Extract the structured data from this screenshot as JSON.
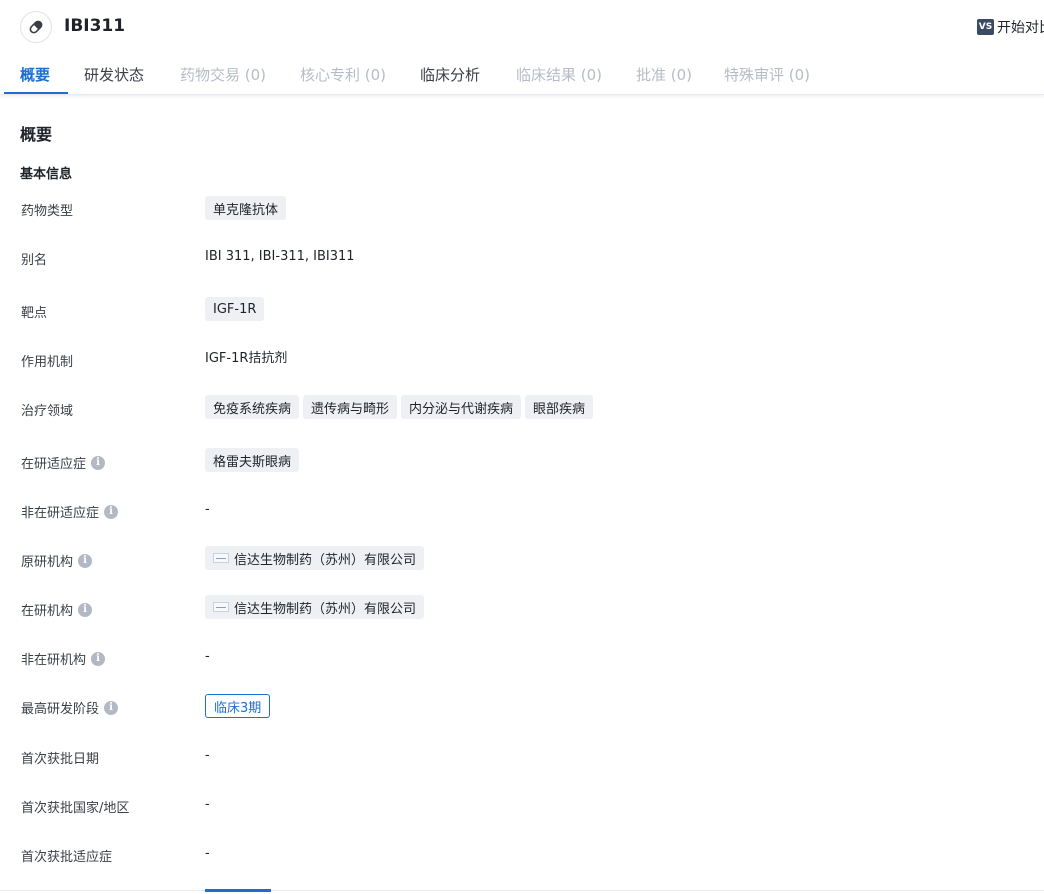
{
  "header": {
    "title": "IBI311",
    "compare_badge": "VS",
    "compare_label": "开始对比",
    "drug_icon": "pill-icon"
  },
  "tabs": [
    {
      "label": "概要",
      "active": true
    },
    {
      "label": "研发状态"
    },
    {
      "label": "药物交易 (0)",
      "disabled": true
    },
    {
      "label": "核心专利 (0)",
      "disabled": true
    },
    {
      "label": "临床分析"
    },
    {
      "label": "临床结果 (0)",
      "disabled": true
    },
    {
      "label": "批准 (0)",
      "disabled": true
    },
    {
      "label": "特殊审评 (0)",
      "disabled": true
    }
  ],
  "section_title": "概要",
  "basic_info": {
    "title": "基本信息",
    "drug_type": {
      "label": "药物类型",
      "tags": [
        "单克隆抗体"
      ]
    },
    "alias": {
      "label": "别名",
      "value": "IBI 311,  IBI-311,  IBI311"
    },
    "target": {
      "label": "靶点",
      "tags": [
        "IGF-1R"
      ]
    },
    "mechanism": {
      "label": "作用机制",
      "value": "IGF-1R拮抗剂"
    },
    "therapeutic_area": {
      "label": "治疗领域",
      "tags": [
        "免疫系统疾病",
        "遗传病与畸形",
        "内分泌与代谢疾病",
        "眼部疾病"
      ]
    },
    "active_indication": {
      "label": "在研适应症",
      "tags": [
        "格雷夫斯眼病"
      ]
    },
    "inactive_indication": {
      "label": "非在研适应症",
      "value": "-"
    },
    "originator": {
      "label": "原研机构",
      "org": "信达生物制药（苏州）有限公司"
    },
    "active_org": {
      "label": "在研机构",
      "org": "信达生物制药（苏州）有限公司"
    },
    "inactive_org": {
      "label": "非在研机构",
      "value": "-"
    },
    "highest_phase": {
      "label": "最高研发阶段",
      "value": "临床3期"
    },
    "first_approval_date": {
      "label": "首次获批日期",
      "value": "-"
    },
    "first_approval_country": {
      "label": "首次获批国家/地区",
      "value": "-"
    },
    "first_approval_indication": {
      "label": "首次获批适应症",
      "value": "-"
    }
  },
  "colors": {
    "accent": "#1c6fd1",
    "tag_bg": "#eef0f4",
    "disabled_tab": "#b6bcc6"
  }
}
